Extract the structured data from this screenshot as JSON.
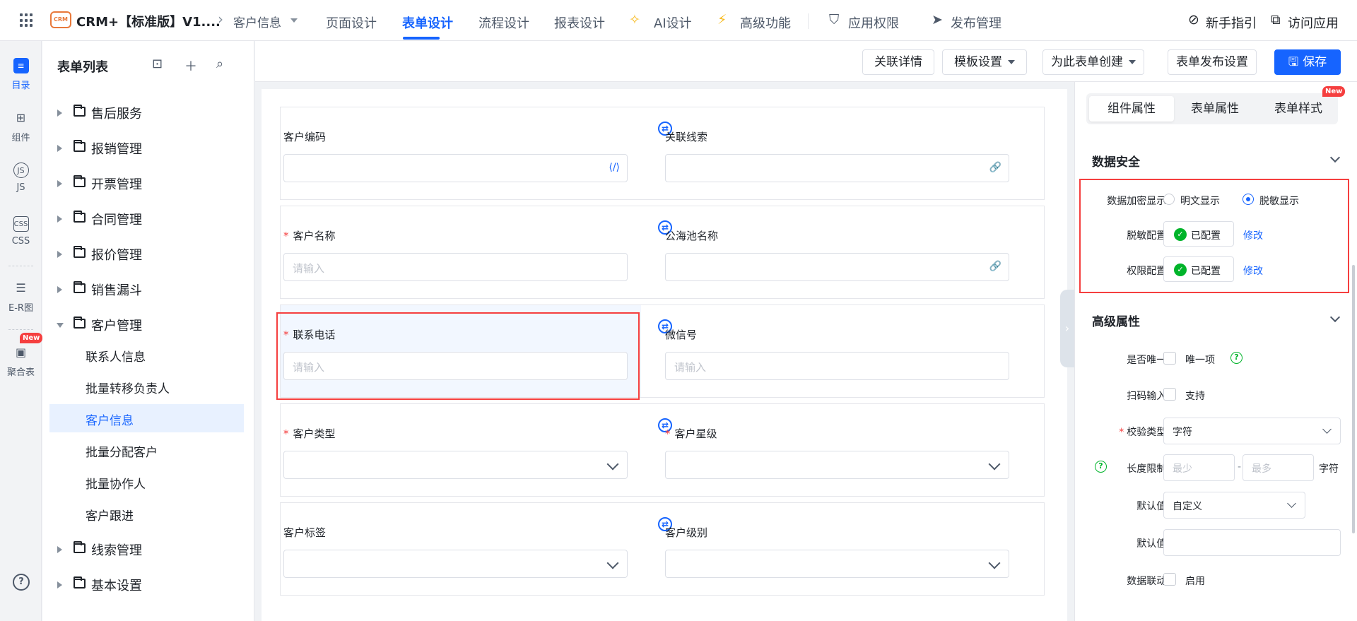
{
  "header": {
    "app_title": "CRM+【标准版】V1....",
    "logo_text": "CRM",
    "breadcrumb_page": "客户信息",
    "tabs": [
      {
        "label": "页面设计"
      },
      {
        "label": "表单设计"
      },
      {
        "label": "流程设计"
      },
      {
        "label": "报表设计"
      },
      {
        "label": "AI设计"
      },
      {
        "label": "高级功能"
      },
      {
        "label": "应用权限"
      },
      {
        "label": "发布管理"
      }
    ],
    "guide_label": "新手指引",
    "visit_label": "访问应用"
  },
  "rail": {
    "items": [
      {
        "label": "目录"
      },
      {
        "label": "组件"
      },
      {
        "label": "JS"
      },
      {
        "label": "CSS"
      },
      {
        "label": "E-R图"
      },
      {
        "label": "聚合表"
      }
    ],
    "new_badge": "New"
  },
  "form_list": {
    "title": "表单列表",
    "folders": [
      {
        "label": "售后服务"
      },
      {
        "label": "报销管理"
      },
      {
        "label": "开票管理"
      },
      {
        "label": "合同管理"
      },
      {
        "label": "报价管理"
      },
      {
        "label": "销售漏斗"
      },
      {
        "label": "客户管理"
      },
      {
        "label": "线索管理"
      },
      {
        "label": "基本设置"
      }
    ],
    "children": [
      {
        "label": "联系人信息"
      },
      {
        "label": "批量转移负责人"
      },
      {
        "label": "客户信息"
      },
      {
        "label": "批量分配客户"
      },
      {
        "label": "批量协作人"
      },
      {
        "label": "客户跟进"
      }
    ]
  },
  "actions": {
    "related_details": "关联详情",
    "template_settings": "模板设置",
    "create_for_form": "为此表单创建",
    "publish_settings": "表单发布设置",
    "save": "保存"
  },
  "form": {
    "required_mark": "*",
    "rows": [
      {
        "left": {
          "label": "客户编码",
          "placeholder": ""
        },
        "right": {
          "label": "关联线索",
          "placeholder": ""
        }
      },
      {
        "left": {
          "label": "客户名称",
          "placeholder": "请输入"
        },
        "right": {
          "label": "公海池名称",
          "placeholder": ""
        }
      },
      {
        "left": {
          "label": "联系电话",
          "placeholder": "请输入"
        },
        "right": {
          "label": "微信号",
          "placeholder": "请输入"
        }
      },
      {
        "left": {
          "label": "客户类型",
          "placeholder": ""
        },
        "right": {
          "label": "客户星级",
          "placeholder": ""
        }
      },
      {
        "left": {
          "label": "客户标签",
          "placeholder": ""
        },
        "right": {
          "label": "客户级别",
          "placeholder": ""
        }
      }
    ]
  },
  "props": {
    "tabs": [
      {
        "label": "组件属性"
      },
      {
        "label": "表单属性"
      },
      {
        "label": "表单样式"
      }
    ],
    "new_badge": "New",
    "data_security": {
      "title": "数据安全",
      "encrypt_label": "数据加密显示:",
      "option_plain": "明文显示",
      "option_masked": "脱敏显示",
      "mask_label": "脱敏配置:",
      "perm_label": "权限配置:",
      "configured": "已配置",
      "edit": "修改"
    },
    "advanced": {
      "title": "高级属性",
      "unique_label": "是否唯一:",
      "unique_text": "唯一项",
      "scan_label": "扫码输入:",
      "scan_text": "支持",
      "validate_label": "校验类型:",
      "validate_value": "字符",
      "length_label": "长度限制:",
      "min_placeholder": "最少",
      "max_placeholder": "最多",
      "length_unit": "字符",
      "range_sep": "-",
      "default_label_1": "默认值:",
      "default_value": "自定义",
      "default_label_2": "默认值:",
      "linkage_label": "数据联动:",
      "linkage_text": "启用"
    }
  },
  "colors": {
    "primary": "#1664ff",
    "danger": "#f53f3f",
    "success": "#00b42a"
  }
}
